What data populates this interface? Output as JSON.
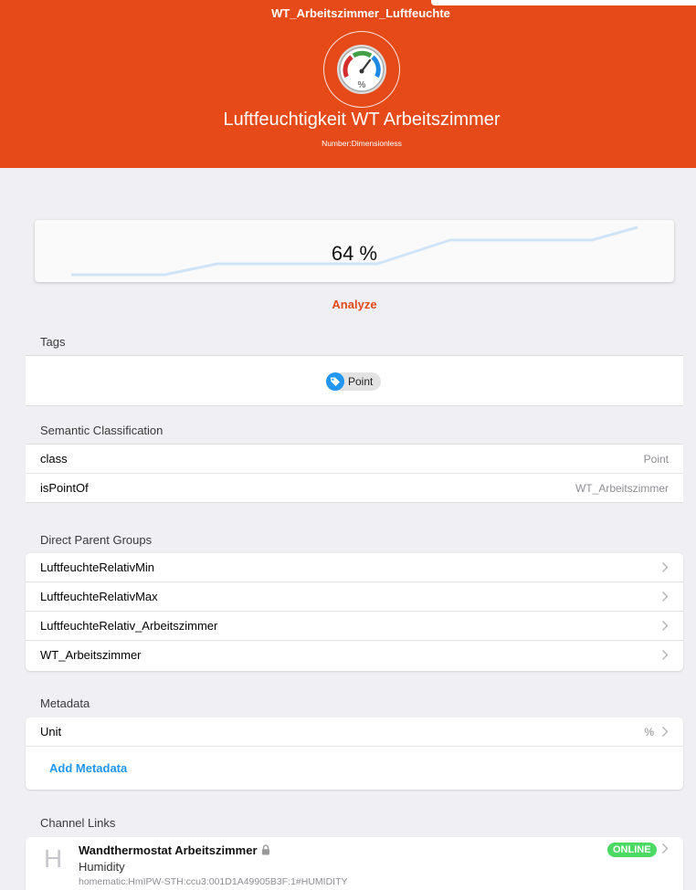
{
  "header": {
    "item_name": "WT_Arbeitszimmer_Luftfeuchte",
    "item_label": "Luftfeuchtigkeit WT Arbeitszimmer",
    "item_type": "Number:Dimensionless",
    "icon": "humidity-gauge-icon",
    "accent_color": "#e64a19"
  },
  "state": {
    "value": "64 %",
    "analyze_label": "Analyze"
  },
  "tags": {
    "title": "Tags",
    "items": [
      "Point"
    ]
  },
  "semantic": {
    "title": "Semantic Classification",
    "rows": [
      {
        "label": "class",
        "value": "Point"
      },
      {
        "label": "isPointOf",
        "value": "WT_Arbeitszimmer"
      }
    ]
  },
  "parent_groups": {
    "title": "Direct Parent Groups",
    "items": [
      "LuftfeuchteRelativMin",
      "LuftfeuchteRelativMax",
      "LuftfeuchteRelativ_Arbeitszimmer",
      "WT_Arbeitszimmer"
    ]
  },
  "metadata": {
    "title": "Metadata",
    "rows": [
      {
        "label": "Unit",
        "value": "%"
      }
    ],
    "add_label": "Add Metadata"
  },
  "channel_links": {
    "title": "Channel Links",
    "items": [
      {
        "avatar": "H",
        "title": "Wandthermostat Arbeitszimmer",
        "subtitle": "Humidity",
        "uid": "homematic:HmIPW-STH:ccu3:001D1A49905B3F:1#HUMIDITY",
        "status": "ONLINE",
        "status_color": "#4cd964"
      }
    ]
  }
}
